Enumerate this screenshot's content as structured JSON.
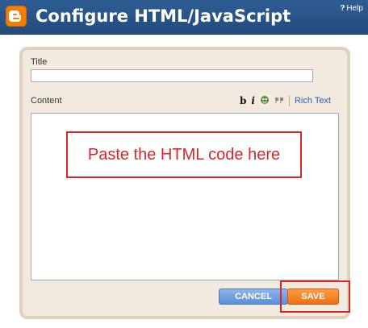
{
  "header": {
    "title": "Configure HTML/JavaScript",
    "help_label": "Help",
    "help_mark": "?"
  },
  "form": {
    "title_label": "Title",
    "title_value": "",
    "content_label": "Content",
    "toolbar": {
      "bold": "b",
      "italic": "i",
      "rich_text": "Rich Text"
    },
    "annotation": "Paste the HTML code here"
  },
  "buttons": {
    "cancel": "CANCEL",
    "save": "SAVE"
  },
  "colors": {
    "header": "#2a5488",
    "panel": "#f3eadf",
    "panel_border": "#e1d2bd",
    "annotation": "#d62828",
    "save": "#f07a1c",
    "cancel": "#6a9ae0",
    "logo": "#f57d00"
  }
}
